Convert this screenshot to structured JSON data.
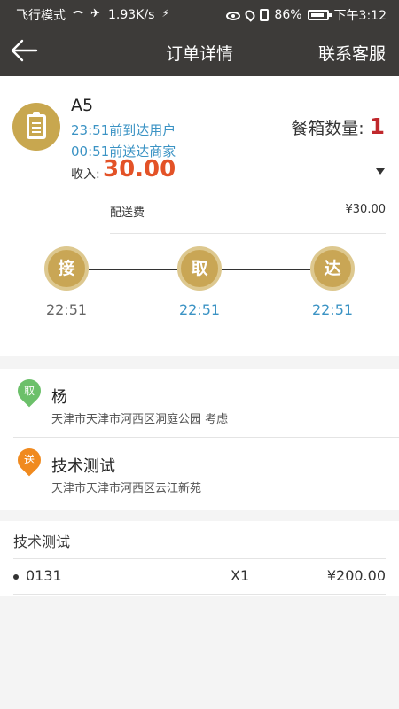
{
  "status_bar": {
    "mode": "飞行模式",
    "speed": "1.93K/s",
    "battery": "86%",
    "time": "下午3:12"
  },
  "header": {
    "title": "订单详情",
    "service_label": "联系客服"
  },
  "order": {
    "code": "A5",
    "deliver_deadline": "23:51前到达用户",
    "pickup_deadline": "00:51前送达商家",
    "box_count_label": "餐箱数量:",
    "box_count": "1",
    "income_label": "收入:",
    "income_value": "30.00",
    "fee_label": "配送费",
    "fee_value": "¥30.00"
  },
  "timeline": {
    "steps": [
      {
        "label": "接",
        "time": "22:51"
      },
      {
        "label": "取",
        "time": "22:51"
      },
      {
        "label": "达",
        "time": "22:51"
      }
    ]
  },
  "addresses": {
    "pickup": {
      "tag": "取",
      "name": "杨",
      "address": "天津市天津市河西区洞庭公园 考虑"
    },
    "delivery": {
      "tag": "送",
      "name": "技术测试",
      "address": "天津市天津市河西区云江新苑"
    }
  },
  "goods": {
    "title": "技术测试",
    "items": [
      {
        "code": "0131",
        "qty": "X1",
        "price": "¥200.00"
      }
    ]
  },
  "colors": {
    "header_bg": "#3d3b39",
    "gold": "#c9a655",
    "blue_text": "#3b93c4",
    "income_orange": "#e35227",
    "count_red": "#c0282c"
  }
}
